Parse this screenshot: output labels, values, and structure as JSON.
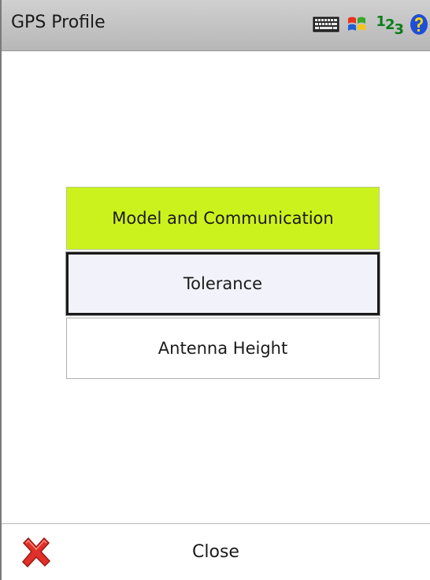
{
  "header": {
    "title": "GPS Profile",
    "input_mode": {
      "one": "1",
      "two": "2",
      "three": "3"
    },
    "icons": [
      "keyboard-icon",
      "windows-start-icon",
      "input-mode-icon",
      "help-icon"
    ]
  },
  "menu": {
    "items": [
      {
        "label": "Model and Communication",
        "state": "highlighted",
        "color": "#ccf21e"
      },
      {
        "label": "Tolerance",
        "state": "focused"
      },
      {
        "label": "Antenna Height",
        "state": "normal"
      }
    ]
  },
  "footer": {
    "close_label": "Close",
    "close_icon": "close-icon",
    "close_icon_color": "#e0302a"
  }
}
